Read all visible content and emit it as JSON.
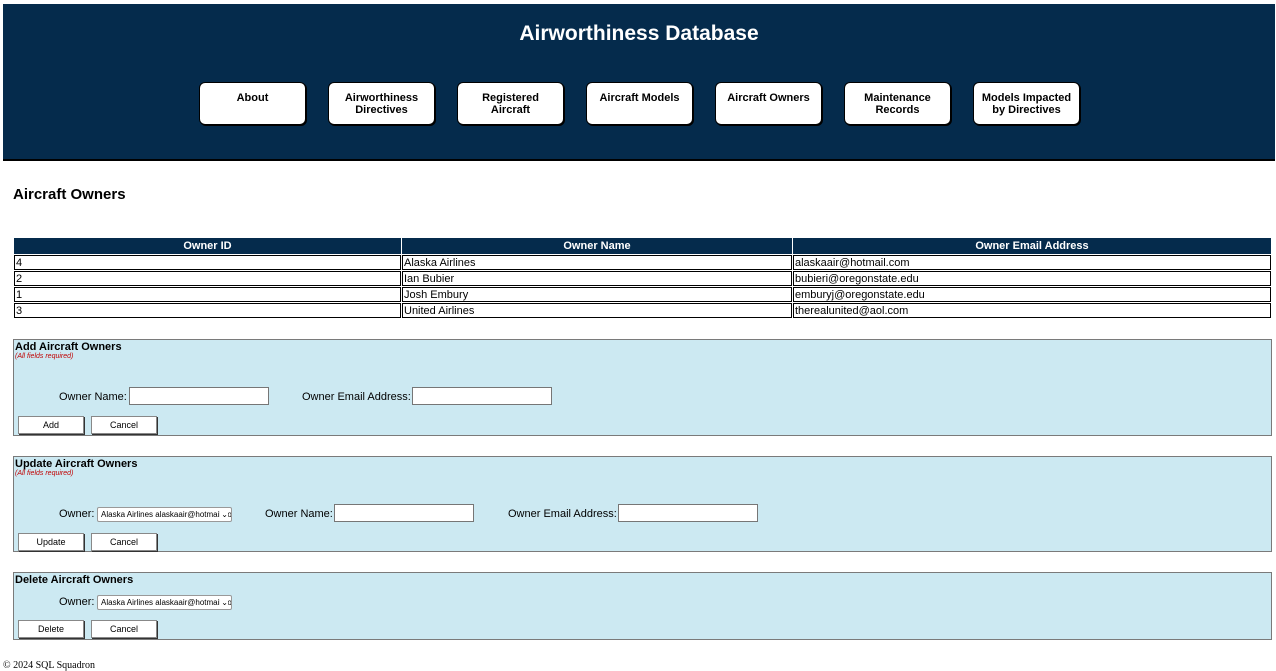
{
  "header": {
    "title": "Airworthiness Database",
    "nav": [
      {
        "label": "About"
      },
      {
        "label": "Airworthiness\nDirectives"
      },
      {
        "label": "Registered\nAircraft"
      },
      {
        "label": "Aircraft Models"
      },
      {
        "label": "Aircraft Owners"
      },
      {
        "label": "Maintenance\nRecords"
      },
      {
        "label": "Models Impacted\nby Directives"
      }
    ]
  },
  "page": {
    "title": "Aircraft Owners"
  },
  "table": {
    "columns": [
      "Owner ID",
      "Owner Name",
      "Owner Email Address"
    ],
    "rows": [
      [
        "4",
        "Alaska Airlines",
        "alaskaair@hotmail.com"
      ],
      [
        "2",
        "Ian Bubier",
        "bubieri@oregonstate.edu"
      ],
      [
        "1",
        "Josh Embury",
        "emburyj@oregonstate.edu"
      ],
      [
        "3",
        "United Airlines",
        "therealunited@aol.com"
      ]
    ]
  },
  "add": {
    "title": "Add Aircraft Owners",
    "note": "(All fields required)",
    "name_label": "Owner Name:",
    "email_label": "Owner Email Address:",
    "name_value": "",
    "email_value": "",
    "submit_label": "Add",
    "cancel_label": "Cancel"
  },
  "update": {
    "title": "Update Aircraft Owners",
    "note": "(All fields required)",
    "owner_label": "Owner:",
    "owner_selected": "Alaska Airlines alaskaair@hotmail.com",
    "name_label": "Owner Name:",
    "email_label": "Owner Email Address:",
    "name_value": "",
    "email_value": "",
    "submit_label": "Update",
    "cancel_label": "Cancel"
  },
  "delete": {
    "title": "Delete Aircraft Owners",
    "owner_label": "Owner:",
    "owner_selected": "Alaska Airlines alaskaair@hotmail.com",
    "submit_label": "Delete",
    "cancel_label": "Cancel"
  },
  "footer": {
    "text": "© 2024 SQL Squadron"
  },
  "colors": {
    "header_bg": "#052b4c",
    "panel_bg": "#cce9f2",
    "note_red": "#c00000"
  }
}
